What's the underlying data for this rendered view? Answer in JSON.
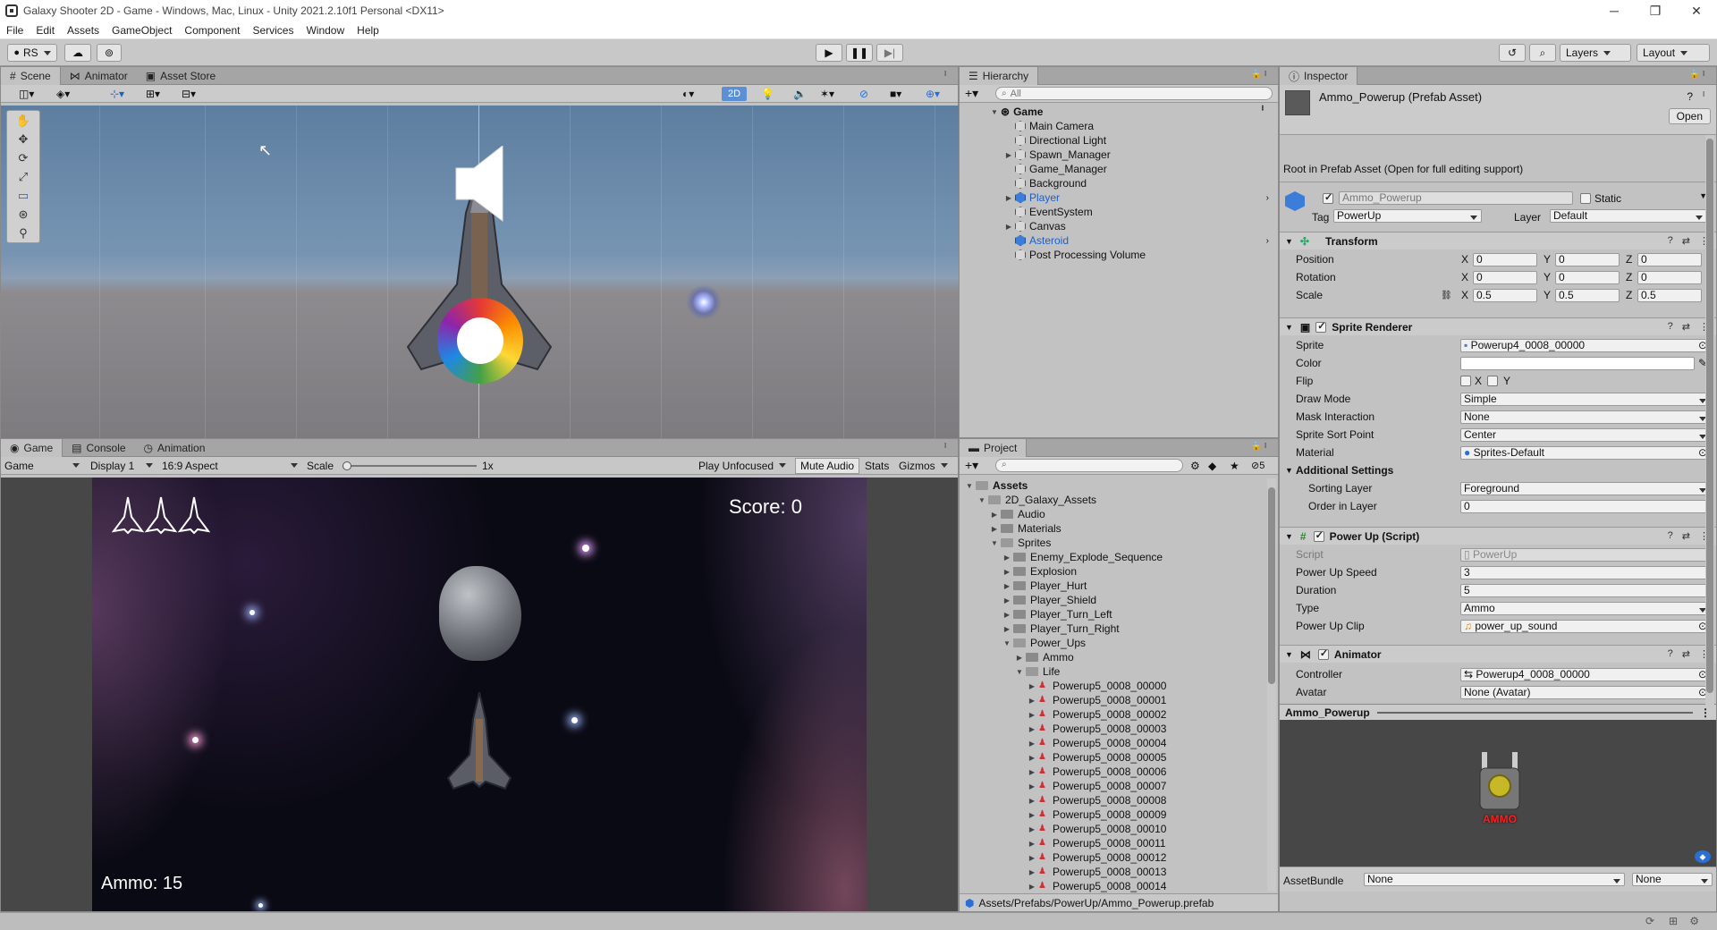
{
  "window": {
    "title": "Galaxy Shooter 2D - Game - Windows, Mac, Linux - Unity 2021.2.10f1 Personal <DX11>"
  },
  "menu": [
    "File",
    "Edit",
    "Assets",
    "GameObject",
    "Component",
    "Services",
    "Window",
    "Help"
  ],
  "toolbar": {
    "account": "RS",
    "layers": "Layers",
    "layout": "Layout"
  },
  "scene_panel": {
    "tabs": [
      "Scene",
      "Animator",
      "Asset Store"
    ],
    "mode_2d": "2D"
  },
  "game_panel": {
    "tabs": [
      "Game",
      "Console",
      "Animation"
    ],
    "display_mode": "Game",
    "display": "Display 1",
    "aspect": "16:9 Aspect",
    "scale_label": "Scale",
    "scale_value": "1x",
    "play_focus": "Play Unfocused",
    "mute_audio": "Mute Audio",
    "stats": "Stats",
    "gizmos": "Gizmos",
    "hud": {
      "score": "Score: 0",
      "ammo": "Ammo: 15"
    }
  },
  "hierarchy": {
    "tab": "Hierarchy",
    "search_placeholder": "All",
    "scene": "Game",
    "items": [
      {
        "label": "Main Camera",
        "expandable": false,
        "prefab": false
      },
      {
        "label": "Directional Light",
        "expandable": false,
        "prefab": false
      },
      {
        "label": "Spawn_Manager",
        "expandable": true,
        "prefab": false
      },
      {
        "label": "Game_Manager",
        "expandable": false,
        "prefab": false
      },
      {
        "label": "Background",
        "expandable": false,
        "prefab": false
      },
      {
        "label": "Player",
        "expandable": true,
        "prefab": true
      },
      {
        "label": "EventSystem",
        "expandable": false,
        "prefab": false
      },
      {
        "label": "Canvas",
        "expandable": true,
        "prefab": false
      },
      {
        "label": "Asteroid",
        "expandable": false,
        "prefab": true
      },
      {
        "label": "Post Processing Volume",
        "expandable": false,
        "prefab": false
      }
    ]
  },
  "project": {
    "tab": "Project",
    "hidden_count": "5",
    "tree": [
      {
        "label": "Assets",
        "level": 0,
        "type": "folder-open"
      },
      {
        "label": "2D_Galaxy_Assets",
        "level": 1,
        "type": "folder-open"
      },
      {
        "label": "Audio",
        "level": 2,
        "type": "folder"
      },
      {
        "label": "Materials",
        "level": 2,
        "type": "folder"
      },
      {
        "label": "Sprites",
        "level": 2,
        "type": "folder-open"
      },
      {
        "label": "Enemy_Explode_Sequence",
        "level": 3,
        "type": "folder"
      },
      {
        "label": "Explosion",
        "level": 3,
        "type": "folder"
      },
      {
        "label": "Player_Hurt",
        "level": 3,
        "type": "folder"
      },
      {
        "label": "Player_Shield",
        "level": 3,
        "type": "folder"
      },
      {
        "label": "Player_Turn_Left",
        "level": 3,
        "type": "folder"
      },
      {
        "label": "Player_Turn_Right",
        "level": 3,
        "type": "folder"
      },
      {
        "label": "Power_Ups",
        "level": 3,
        "type": "folder-open"
      },
      {
        "label": "Ammo",
        "level": 4,
        "type": "folder"
      },
      {
        "label": "Life",
        "level": 4,
        "type": "folder-open"
      },
      {
        "label": "Powerup5_0008_00000",
        "level": 5,
        "type": "sprite"
      },
      {
        "label": "Powerup5_0008_00001",
        "level": 5,
        "type": "sprite"
      },
      {
        "label": "Powerup5_0008_00002",
        "level": 5,
        "type": "sprite"
      },
      {
        "label": "Powerup5_0008_00003",
        "level": 5,
        "type": "sprite"
      },
      {
        "label": "Powerup5_0008_00004",
        "level": 5,
        "type": "sprite"
      },
      {
        "label": "Powerup5_0008_00005",
        "level": 5,
        "type": "sprite"
      },
      {
        "label": "Powerup5_0008_00006",
        "level": 5,
        "type": "sprite"
      },
      {
        "label": "Powerup5_0008_00007",
        "level": 5,
        "type": "sprite"
      },
      {
        "label": "Powerup5_0008_00008",
        "level": 5,
        "type": "sprite"
      },
      {
        "label": "Powerup5_0008_00009",
        "level": 5,
        "type": "sprite"
      },
      {
        "label": "Powerup5_0008_00010",
        "level": 5,
        "type": "sprite"
      },
      {
        "label": "Powerup5_0008_00011",
        "level": 5,
        "type": "sprite"
      },
      {
        "label": "Powerup5_0008_00012",
        "level": 5,
        "type": "sprite"
      },
      {
        "label": "Powerup5_0008_00013",
        "level": 5,
        "type": "sprite"
      },
      {
        "label": "Powerup5_0008_00014",
        "level": 5,
        "type": "sprite"
      }
    ],
    "path": "Assets/Prefabs/PowerUp/Ammo_Powerup.prefab"
  },
  "inspector": {
    "tab": "Inspector",
    "asset_title": "Ammo_Powerup (Prefab Asset)",
    "open_button": "Open",
    "root_note": "Root in Prefab Asset (Open for full editing support)",
    "name": "Ammo_Powerup",
    "static_label": "Static",
    "tag_label": "Tag",
    "tag": "PowerUp",
    "layer_label": "Layer",
    "layer": "Default",
    "transform": {
      "title": "Transform",
      "position": {
        "label": "Position",
        "x": "0",
        "y": "0",
        "z": "0"
      },
      "rotation": {
        "label": "Rotation",
        "x": "0",
        "y": "0",
        "z": "0"
      },
      "scale": {
        "label": "Scale",
        "x": "0.5",
        "y": "0.5",
        "z": "0.5"
      }
    },
    "sprite_renderer": {
      "title": "Sprite Renderer",
      "sprite_label": "Sprite",
      "sprite": "Powerup4_0008_00000",
      "color_label": "Color",
      "flip_label": "Flip",
      "flip_x": "X",
      "flip_y": "Y",
      "draw_mode_label": "Draw Mode",
      "draw_mode": "Simple",
      "mask_label": "Mask Interaction",
      "mask": "None",
      "sort_point_label": "Sprite Sort Point",
      "sort_point": "Center",
      "material_label": "Material",
      "material": "Sprites-Default",
      "additional": "Additional Settings",
      "sorting_layer_label": "Sorting Layer",
      "sorting_layer": "Foreground",
      "order_label": "Order in Layer",
      "order": "0"
    },
    "power_up": {
      "title": "Power Up (Script)",
      "script_label": "Script",
      "script": "PowerUp",
      "speed_label": "Power Up Speed",
      "speed": "3",
      "duration_label": "Duration",
      "duration": "5",
      "type_label": "Type",
      "type": "Ammo",
      "clip_label": "Power Up Clip",
      "clip": "power_up_sound"
    },
    "animator": {
      "title": "Animator",
      "controller_label": "Controller",
      "controller": "Powerup4_0008_00000",
      "avatar_label": "Avatar",
      "avatar": "None (Avatar)"
    },
    "preview": {
      "title": "Ammo_Powerup",
      "sprite_text": "AMMO"
    },
    "assetbundle": {
      "label": "AssetBundle",
      "name": "None",
      "variant": "None"
    }
  }
}
